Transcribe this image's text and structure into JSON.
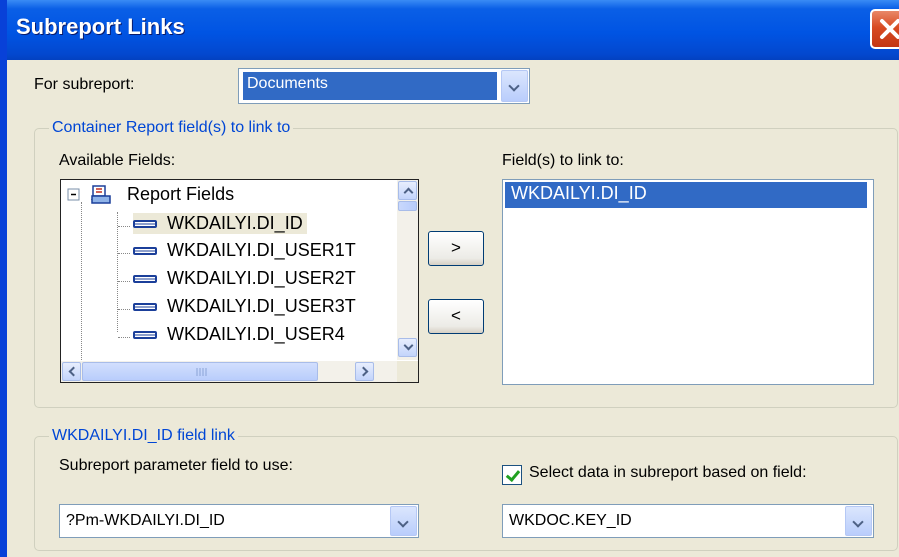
{
  "window": {
    "title": "Subreport Links"
  },
  "for_subreport": {
    "label": "For subreport:",
    "value": "Documents"
  },
  "container_group": {
    "legend": "Container Report field(s) to link to",
    "available_label": "Available Fields:",
    "tree": {
      "root_label": "Report Fields",
      "items": [
        "WKDAILYI.DI_ID",
        "WKDAILYI.DI_USER1T",
        "WKDAILYI.DI_USER2T",
        "WKDAILYI.DI_USER3T",
        "WKDAILYI.DI_USER4"
      ]
    },
    "add_button": ">",
    "remove_button": "<",
    "linked_label": "Field(s) to link to:",
    "linked_items": [
      "WKDAILYI.DI_ID"
    ]
  },
  "link_group": {
    "legend": "WKDAILYI.DI_ID field link",
    "param_label": "Subreport parameter field to use:",
    "param_value": "?Pm-WKDAILYI.DI_ID",
    "select_checkbox_label": "Select data in subreport based on field:",
    "select_checkbox_checked": true,
    "select_field_value": "WKDOC.KEY_ID"
  }
}
